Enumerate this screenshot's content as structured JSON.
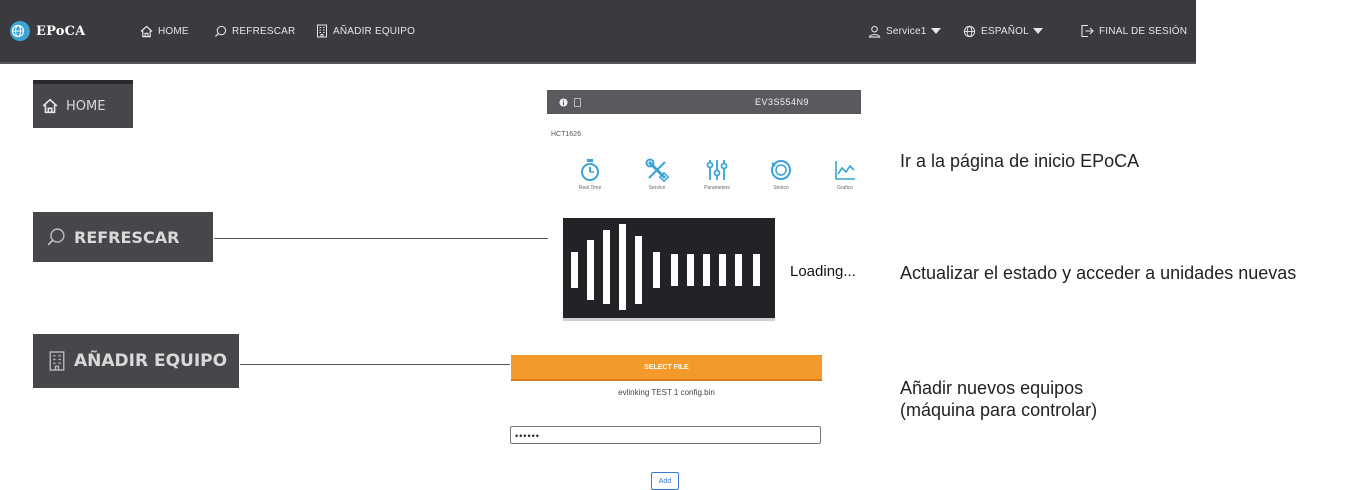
{
  "nav": {
    "brand": "EPoCA",
    "home": "HOME",
    "refresh": "REFRESCAR",
    "add_equipment": "AÑADIR EQUIPO",
    "user": "Service1",
    "language": "ESPAÑOL",
    "logout": "FINAL DE SESIÓN"
  },
  "zoomed": {
    "home": "HOME",
    "refresh": "REFRESCAR",
    "add_equipment": "AÑADIR EQUIPO"
  },
  "device": {
    "id": "EV3S554N9",
    "model": "HCT1626",
    "tiles": [
      "Real Time",
      "Service",
      "Parameters",
      "Storico",
      "Grafico"
    ]
  },
  "loading": {
    "text": "Loading..."
  },
  "add_form": {
    "select_file": "SELECT FILE",
    "filename": "evlinking TEST 1 config.bin",
    "password_value": "••••••",
    "add_label": "Add"
  },
  "descriptions": {
    "home": "Ir a la página de inicio EPoCA",
    "refresh": "Actualizar el estado y acceder a unidades nuevas",
    "add_line1": "Añadir nuevos equipos",
    "add_line2": "(máquina para controlar)"
  },
  "colors": {
    "nav_bg": "#3b3b3f",
    "select_file_bg": "#f39a2a",
    "tile_icon": "#3aa3d6",
    "add_button": "#3a7dc9"
  },
  "icons": {
    "brand": "globe-logo-icon",
    "home": "home-icon",
    "refresh": "search-icon",
    "add": "building-icon",
    "user": "user-icon",
    "language": "globe-icon",
    "logout": "logout-icon",
    "tiles": [
      "stopwatch-icon",
      "tools-icon",
      "sliders-icon",
      "history-icon",
      "chart-icon"
    ]
  }
}
